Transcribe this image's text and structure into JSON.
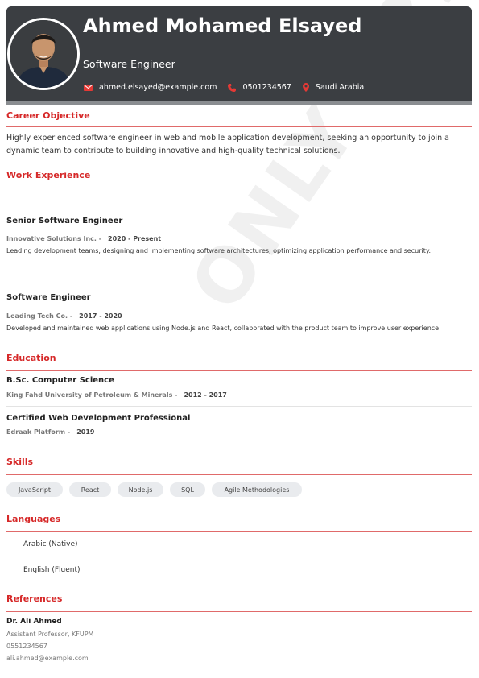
{
  "header": {
    "name": "Ahmed Mohamed Elsayed",
    "title": "Software Engineer",
    "email": "ahmed.elsayed@example.com",
    "phone": "0501234567",
    "location": "Saudi Arabia"
  },
  "watermark": "ONLY PRE",
  "objective": {
    "heading": "Career Objective",
    "text": "Highly experienced software engineer in web and mobile application development, seeking an opportunity to join a dynamic team to contribute to building innovative and high-quality technical solutions."
  },
  "experience": {
    "heading": "Work Experience",
    "jobs": [
      {
        "title": "Senior Software Engineer",
        "company": "Innovative Solutions Inc. -",
        "dates": "2020 - Present",
        "description": "Leading development teams, designing and implementing software architectures, optimizing application performance and security."
      },
      {
        "title": "Software Engineer",
        "company": "Leading Tech Co. -",
        "dates": "2017 - 2020",
        "description": "Developed and maintained web applications using Node.js and React, collaborated with the product team to improve user experience."
      }
    ]
  },
  "education": {
    "heading": "Education",
    "items": [
      {
        "title": "B.Sc. Computer Science",
        "institution": "King Fahd University of Petroleum & Minerals -",
        "dates": "2012 - 2017"
      },
      {
        "title": "Certified Web Development Professional",
        "institution": "Edraak Platform -",
        "dates": "2019"
      }
    ]
  },
  "skills": {
    "heading": "Skills",
    "items": [
      "JavaScript",
      "React",
      "Node.js",
      "SQL",
      "Agile Methodologies"
    ]
  },
  "languages": {
    "heading": "Languages",
    "items": [
      "Arabic (Native)",
      "English (Fluent)"
    ]
  },
  "references": {
    "heading": "References",
    "name": "Dr. Ali Ahmed",
    "position": "Assistant Professor, KFUPM",
    "phone": "0551234567",
    "email": "ali.ahmed@example.com"
  },
  "colors": {
    "accent": "#d62828",
    "header_bg": "#3b3e42"
  },
  "icons": {
    "email": "envelope-icon",
    "phone": "phone-icon",
    "location": "location-pin-icon"
  }
}
